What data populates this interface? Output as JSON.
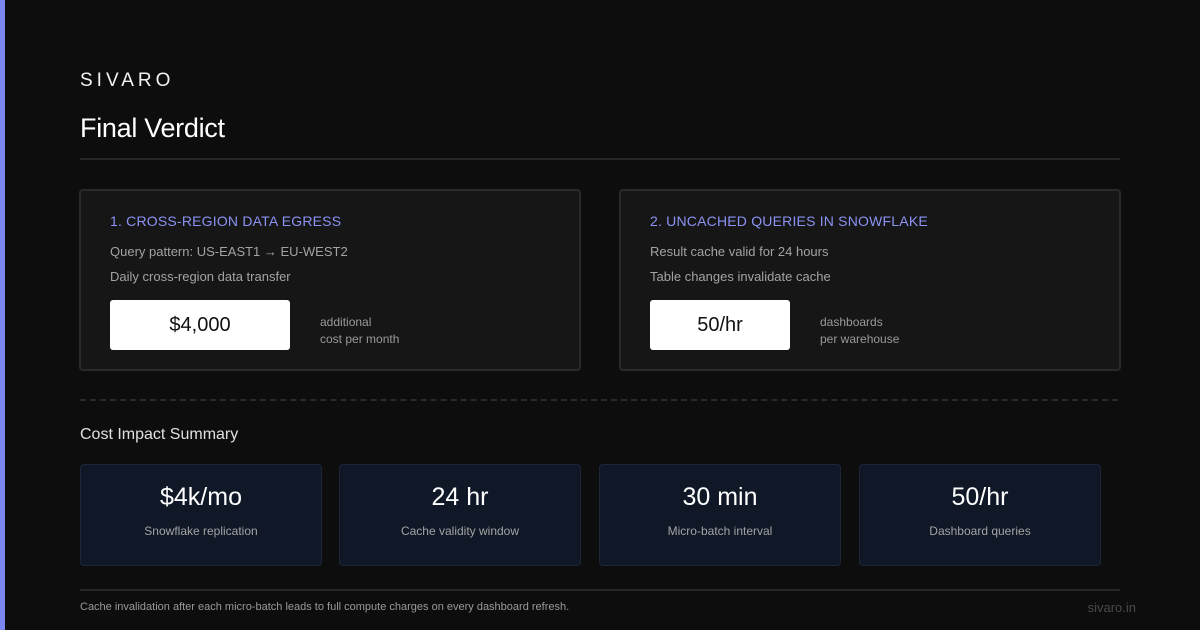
{
  "brand": "SIVARO",
  "title": "Final Verdict",
  "cards": [
    {
      "heading": "1. CROSS-REGION DATA EGRESS",
      "line1": "Query pattern: US-EAST1 → EU-WEST2",
      "line2": "Daily cross-region data transfer",
      "value": "$4,000",
      "note1": "additional",
      "note2": "cost per month"
    },
    {
      "heading": "2. UNCACHED QUERIES IN SNOWFLAKE",
      "line1": "Result cache valid for 24 hours",
      "line2": "Table changes invalidate cache",
      "value": "50/hr",
      "note1": "dashboards",
      "note2": "per warehouse"
    }
  ],
  "summary": {
    "title": "Cost Impact Summary",
    "stats": [
      {
        "value": "$4k/mo",
        "label": "Snowflake replication"
      },
      {
        "value": "24 hr",
        "label": "Cache validity window"
      },
      {
        "value": "30 min",
        "label": "Micro-batch interval"
      },
      {
        "value": "50/hr",
        "label": "Dashboard queries"
      }
    ]
  },
  "footer": {
    "note": "Cache invalidation after each micro-batch leads to full compute charges on every dashboard refresh.",
    "site": "sivaro.in"
  },
  "colors": {
    "accent": "#7b86f0",
    "background": "#0d0d0d",
    "card": "#161616",
    "stat_card": "#101827",
    "heading_accent": "#8b93f4"
  }
}
